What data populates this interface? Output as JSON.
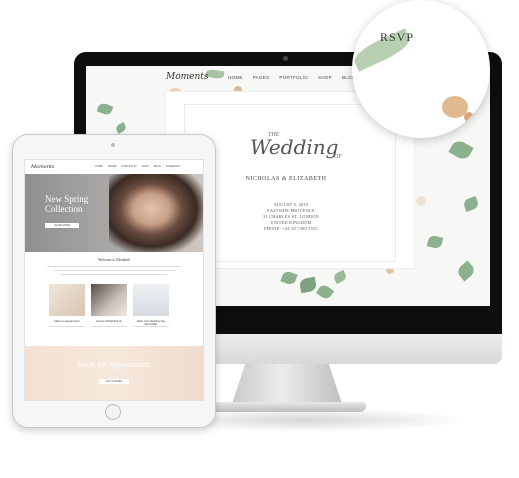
{
  "desktop": {
    "site": {
      "logo": "Moments",
      "nav": [
        "HOME",
        "PAGES",
        "PORTFOLIO",
        "SHOP",
        "BLOG",
        "ELEMENTS"
      ]
    },
    "invitation": {
      "the": "THE",
      "wedding": "Wedding",
      "of": "OF",
      "couple": "NICHOLAS & ELIZABETH",
      "details": [
        "AUGUST 5, 2016",
        "EASTSIDE PROVENCE",
        "31 CHARLES ST. LONDON",
        "UNITED KINGDOM",
        "PHONE: +44 20 7300 5555"
      ]
    },
    "magnifier": {
      "label": "RSVP"
    }
  },
  "tablet": {
    "logo": "Moments",
    "nav": [
      "HOME",
      "PAGES",
      "PORTFOLIO",
      "SHOP",
      "BLOG",
      "ELEMENTS"
    ],
    "hero": {
      "title_line1": "New Spring",
      "title_line2": "Collection",
      "button": "LEARN MORE"
    },
    "welcome": "Welcome to Elizabeth",
    "tiles": [
      "Make an appointment",
      "Famous Bridal Brands",
      "Make Your Wedding Day Memorable"
    ],
    "promo": {
      "title": "Book An Appointment",
      "button": "GET STARTED"
    }
  }
}
